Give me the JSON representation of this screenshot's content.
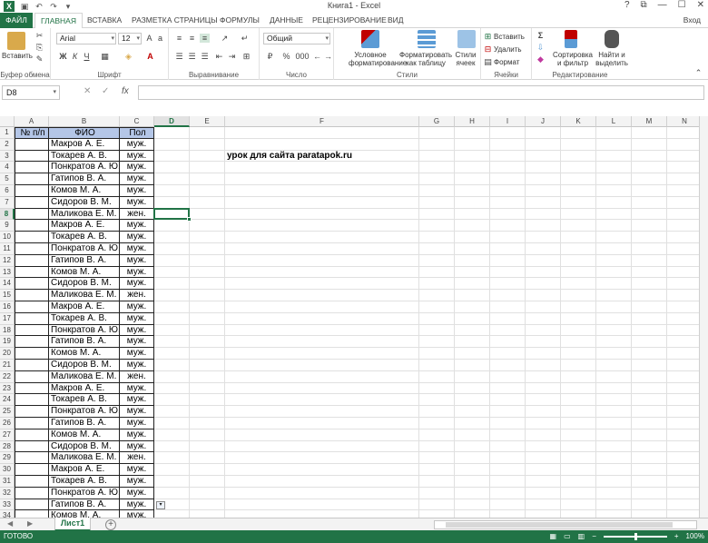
{
  "titlebar": {
    "title": "Книга1 - Excel",
    "help": "?",
    "restore": "⧉",
    "minimize": "—",
    "maximize": "☐",
    "close": "✕"
  },
  "tabs": {
    "file": "ФАЙЛ",
    "home": "ГЛАВНАЯ",
    "insert": "ВСТАВКА",
    "layout": "РАЗМЕТКА СТРАНИЦЫ",
    "formulas": "ФОРМУЛЫ",
    "data": "ДАННЫЕ",
    "review": "РЕЦЕНЗИРОВАНИЕ",
    "view": "ВИД",
    "signin": "Вход"
  },
  "ribbon": {
    "clipboard": {
      "paste": "Вставить",
      "label": "Буфер обмена"
    },
    "font": {
      "name": "Arial",
      "size": "12",
      "label": "Шрифт",
      "bold": "Ж",
      "italic": "К",
      "underline": "Ч"
    },
    "alignment": {
      "label": "Выравнивание"
    },
    "number": {
      "format": "Общий",
      "label": "Число",
      "percent": "%",
      "thousands": "000"
    },
    "styles": {
      "conditional": "Условное форматирование",
      "as_table": "Форматировать как таблицу",
      "cell_styles": "Стили ячеек",
      "label": "Стили"
    },
    "cells": {
      "insert": "Вставить",
      "delete": "Удалить",
      "format": "Формат",
      "label": "Ячейки"
    },
    "editing": {
      "sort": "Сортировка и фильтр",
      "find": "Найти и выделить",
      "label": "Редактирование"
    }
  },
  "formula_bar": {
    "name_box": "D8",
    "cancel": "✕",
    "enter": "✓",
    "fx": "fx",
    "value": ""
  },
  "columns": [
    "A",
    "B",
    "C",
    "D",
    "E",
    "F",
    "G",
    "H",
    "I",
    "J",
    "K",
    "L",
    "M",
    "N"
  ],
  "selected_column": "D",
  "selected_row": 8,
  "table": {
    "headers": [
      "№ п/п",
      "ФИО",
      "Пол"
    ],
    "rows": [
      [
        "Макров А. Е.",
        "муж."
      ],
      [
        "Токарев А. В.",
        "муж."
      ],
      [
        "Понкратов А. Ю.",
        "муж."
      ],
      [
        "Гатипов В. А.",
        "муж."
      ],
      [
        "Комов М. А.",
        "муж."
      ],
      [
        "Сидоров В. М.",
        "муж."
      ],
      [
        "Маликова Е. М.",
        "жен."
      ],
      [
        "Макров А. Е.",
        "муж."
      ],
      [
        "Токарев А. В.",
        "муж."
      ],
      [
        "Понкратов А. Ю.",
        "муж."
      ],
      [
        "Гатипов В. А.",
        "муж."
      ],
      [
        "Комов М. А.",
        "муж."
      ],
      [
        "Сидоров В. М.",
        "муж."
      ],
      [
        "Маликова Е. М.",
        "жен."
      ],
      [
        "Макров А. Е.",
        "муж."
      ],
      [
        "Токарев А. В.",
        "муж."
      ],
      [
        "Понкратов А. Ю.",
        "муж."
      ],
      [
        "Гатипов В. А.",
        "муж."
      ],
      [
        "Комов М. А.",
        "муж."
      ],
      [
        "Сидоров В. М.",
        "муж."
      ],
      [
        "Маликова Е. М.",
        "жен."
      ],
      [
        "Макров А. Е.",
        "муж."
      ],
      [
        "Токарев А. В.",
        "муж."
      ],
      [
        "Понкратов А. Ю.",
        "муж."
      ],
      [
        "Гатипов В. А.",
        "муж."
      ],
      [
        "Комов М. А.",
        "муж."
      ],
      [
        "Сидоров В. М.",
        "муж."
      ],
      [
        "Маликова Е. М.",
        "жен."
      ],
      [
        "Макров А. Е.",
        "муж."
      ],
      [
        "Токарев А. В.",
        "муж."
      ],
      [
        "Понкратов А. Ю.",
        "муж."
      ],
      [
        "Гатипов В. А.",
        "муж."
      ],
      [
        "Комов М. А.",
        "муж."
      ]
    ]
  },
  "note": "урок для сайта paratapok.ru",
  "sheet": {
    "name": "Лист1",
    "add": "+"
  },
  "status": {
    "ready": "ГОТОВО",
    "zoom": "100%",
    "zoom_out": "−",
    "zoom_in": "+"
  }
}
